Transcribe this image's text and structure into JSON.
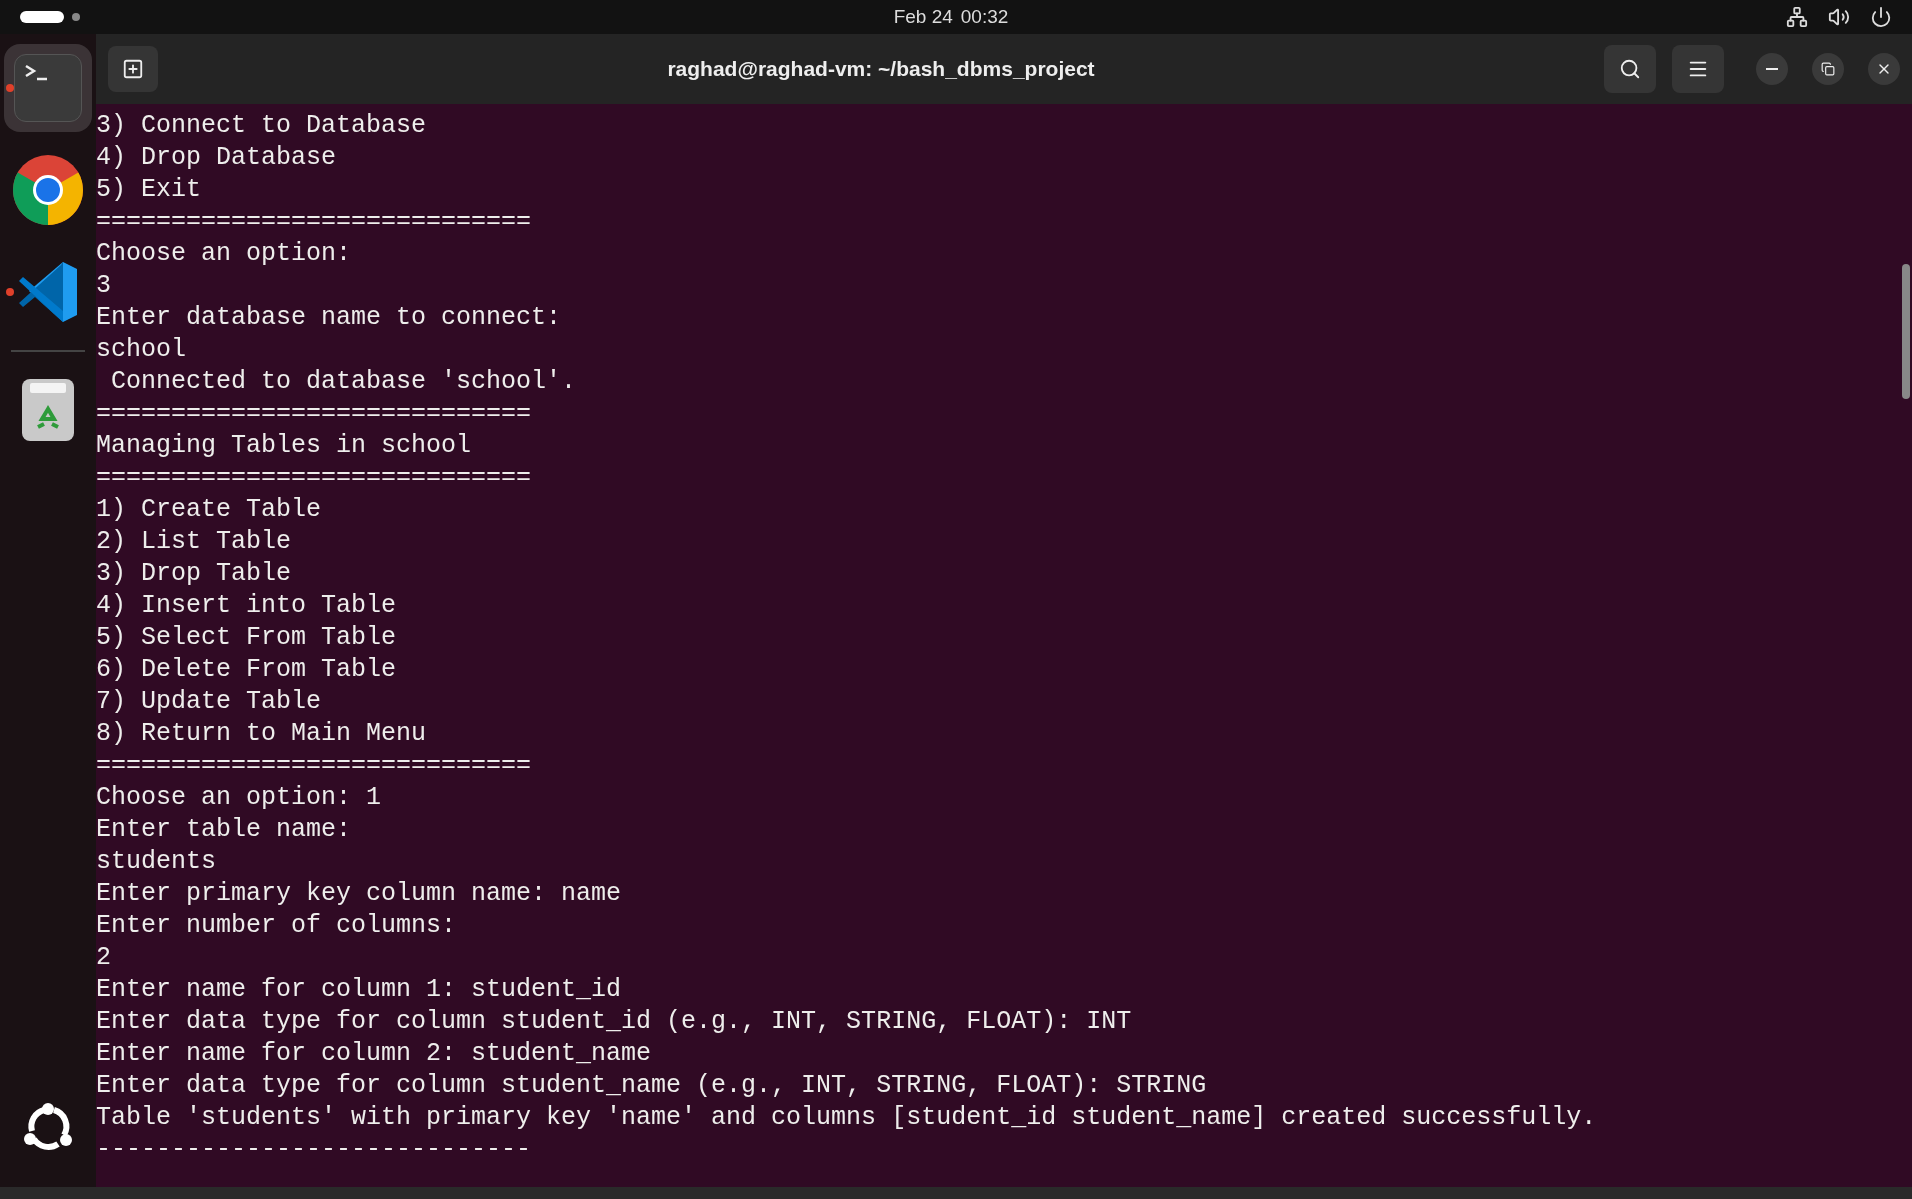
{
  "top_bar": {
    "date": "Feb 24",
    "time": "00:32"
  },
  "dock": {
    "items": [
      {
        "kind": "terminal",
        "selected": true,
        "running": true
      },
      {
        "kind": "browser",
        "selected": false,
        "running": false
      },
      {
        "kind": "editor",
        "selected": false,
        "running": true
      },
      {
        "kind": "trash",
        "selected": false,
        "running": false
      }
    ]
  },
  "terminal": {
    "title": "raghad@raghad-vm: ~/bash_dbms_project",
    "lines": [
      "3) Connect to Database",
      "4) Drop Database",
      "5) Exit",
      "=============================",
      "Choose an option:",
      "3",
      "Enter database name to connect:",
      "school",
      " Connected to database 'school'.",
      "=============================",
      "Managing Tables in school",
      "=============================",
      "1) Create Table",
      "2) List Table",
      "3) Drop Table",
      "4) Insert into Table",
      "5) Select From Table",
      "6) Delete From Table",
      "7) Update Table",
      "8) Return to Main Menu",
      "=============================",
      "Choose an option: 1",
      "Enter table name:",
      "students",
      "Enter primary key column name: name",
      "Enter number of columns:",
      "2",
      "Enter name for column 1: student_id",
      "Enter data type for column student_id (e.g., INT, STRING, FLOAT): INT",
      "Enter name for column 2: student_name",
      "Enter data type for column student_name (e.g., INT, STRING, FLOAT): STRING",
      "Table 'students' with primary key 'name' and columns [student_id student_name] created successfully.",
      "-----------------------------"
    ]
  }
}
